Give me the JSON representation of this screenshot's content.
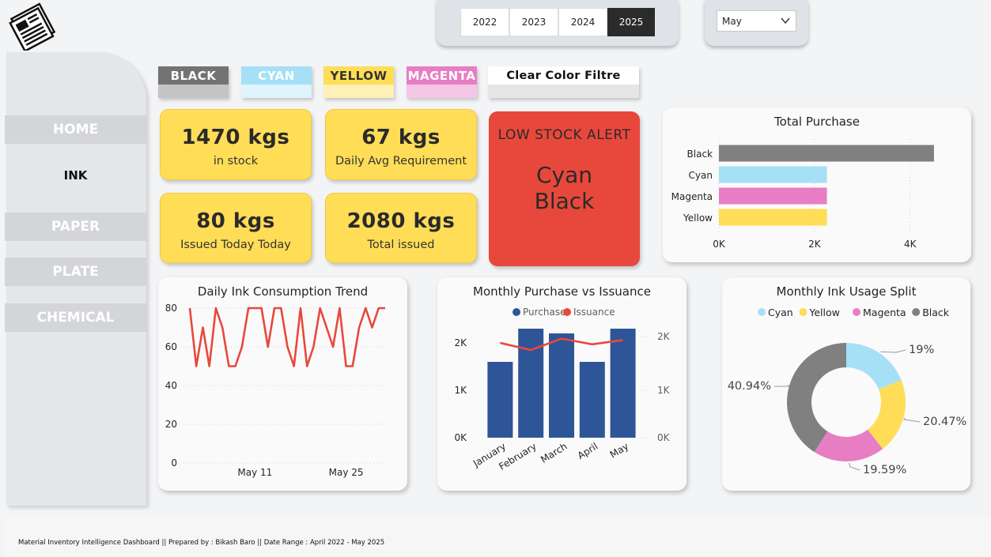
{
  "slicers": {
    "years": [
      "2022",
      "2023",
      "2024",
      "2025"
    ],
    "selected_year": "2025",
    "month": "May"
  },
  "nav": {
    "home": "HOME",
    "ink": "INK",
    "paper": "PAPER",
    "plate": "PLATE",
    "chemical": "CHEMICAL",
    "active": "INK"
  },
  "color_filters": {
    "black": "BLACK",
    "cyan": "CYAN",
    "yellow": "YELLOW",
    "magenta": "MAGENTA",
    "clear": "Clear Color Filtre"
  },
  "colors": {
    "black": "#808080",
    "cyan": "#a6e0f6",
    "yellow": "#ffdd57",
    "magenta": "#e77ec4",
    "purchase": "#2e5597",
    "issuance": "#e8483c",
    "kpi": "#ffdd57",
    "alert": "#e8483c"
  },
  "kpis": {
    "in_stock_value": "1470 kgs",
    "in_stock_label": "in stock",
    "daily_avg_value": "67 kgs",
    "daily_avg_label": "Daily Avg Requirement",
    "issued_today_value": "80 kgs",
    "issued_today_label": "Issued Today Today",
    "total_issued_value": "2080 kgs",
    "total_issued_label": "Total issued"
  },
  "alert": {
    "title": "LOW STOCK ALERT",
    "items": [
      "Cyan",
      "Black"
    ]
  },
  "footer": {
    "text": "Material Inventory Intelligence Dashboard || Prepared by : Bikash Baro || Date Range : April 2022 - May 2025"
  },
  "chart_data": [
    {
      "id": "total_purchase",
      "type": "bar",
      "orientation": "horizontal",
      "title": "Total Purchase",
      "categories": [
        "Black",
        "Cyan",
        "Magenta",
        "Yellow"
      ],
      "values": [
        4500,
        2260,
        2260,
        2260
      ],
      "colors": [
        "#808080",
        "#a6e0f6",
        "#e77ec4",
        "#ffdd57"
      ],
      "xlim": [
        0,
        4700
      ],
      "xticks": [
        0,
        2000,
        4000
      ],
      "xtick_labels": [
        "0K",
        "2K",
        "4K"
      ],
      "grid": true
    },
    {
      "id": "daily_trend",
      "type": "line",
      "title": "Daily Ink Consumption Trend",
      "x": [
        "May 1",
        "May 2",
        "May 3",
        "May 4",
        "May 5",
        "May 6",
        "May 7",
        "May 8",
        "May 9",
        "May 10",
        "May 11",
        "May 12",
        "May 13",
        "May 14",
        "May 15",
        "May 16",
        "May 17",
        "May 18",
        "May 19",
        "May 20",
        "May 21",
        "May 22",
        "May 23",
        "May 24",
        "May 25",
        "May 26",
        "May 27",
        "May 28",
        "May 29",
        "May 30",
        "May 31"
      ],
      "values": [
        80,
        50,
        70,
        50,
        80,
        70,
        50,
        50,
        60,
        80,
        80,
        80,
        60,
        80,
        80,
        60,
        50,
        80,
        50,
        60,
        80,
        70,
        60,
        80,
        50,
        50,
        70,
        80,
        70,
        80,
        80
      ],
      "ylim": [
        0,
        80
      ],
      "yticks": [
        0,
        20,
        40,
        60,
        80
      ],
      "xtick_labels": [
        "May 11",
        "May 25"
      ],
      "color": "#e8483c",
      "grid": true
    },
    {
      "id": "monthly_purchase_issuance",
      "type": "bar",
      "title": "Monthly Purchase vs Issuance",
      "categories": [
        "January",
        "February",
        "March",
        "April",
        "May"
      ],
      "series": [
        {
          "name": "Purchase",
          "type": "bar",
          "values": [
            1600,
            2300,
            2200,
            1600,
            2300
          ],
          "color": "#2e5597"
        },
        {
          "name": "Issuance",
          "type": "line",
          "values": [
            2000,
            1850,
            2090,
            1970,
            2060
          ],
          "color": "#e8483c"
        }
      ],
      "ylim": [
        0,
        2300
      ],
      "yticks_left": [
        "0K",
        "1K",
        "2K"
      ],
      "yticks_right": [
        "0K",
        "1K",
        "2K"
      ],
      "legend": "top"
    },
    {
      "id": "monthly_usage_split",
      "type": "pie",
      "donut": true,
      "title": "Monthly Ink Usage Split",
      "categories": [
        "Cyan",
        "Yellow",
        "Magenta",
        "Black"
      ],
      "values": [
        19.0,
        20.47,
        19.59,
        40.94
      ],
      "labels": [
        "19%",
        "20.47%",
        "19.59%",
        "40.94%"
      ],
      "colors": [
        "#a6e0f6",
        "#ffdd57",
        "#e77ec4",
        "#808080"
      ],
      "legend": "top"
    }
  ]
}
